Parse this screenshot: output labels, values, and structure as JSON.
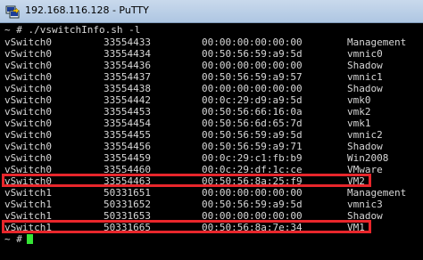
{
  "window": {
    "title": "192.168.116.128 - PuTTY",
    "icon": "putty-icon"
  },
  "terminal": {
    "command_prompt": "~ # ./vswitchInfo.sh -l",
    "rows": [
      [
        "vSwitch0",
        "33554433",
        "00:00:00:00:00:00",
        "Management"
      ],
      [
        "vSwitch0",
        "33554434",
        "00:50:56:59:a9:5d",
        "vmnic0"
      ],
      [
        "vSwitch0",
        "33554436",
        "00:00:00:00:00:00",
        "Shadow"
      ],
      [
        "vSwitch0",
        "33554437",
        "00:50:56:59:a9:57",
        "vmnic1"
      ],
      [
        "vSwitch0",
        "33554438",
        "00:00:00:00:00:00",
        "Shadow"
      ],
      [
        "vSwitch0",
        "33554442",
        "00:0c:29:d9:a9:5d",
        "vmk0"
      ],
      [
        "vSwitch0",
        "33554453",
        "00:50:56:66:16:0a",
        "vmk2"
      ],
      [
        "vSwitch0",
        "33554454",
        "00:50:56:6d:65:7d",
        "vmk1"
      ],
      [
        "vSwitch0",
        "33554455",
        "00:50:56:59:a9:5d",
        "vmnic2"
      ],
      [
        "vSwitch0",
        "33554456",
        "00:50:56:59:a9:71",
        "Shadow"
      ],
      [
        "vSwitch0",
        "33554459",
        "00:0c:29:c1:fb:b9",
        "Win2008"
      ],
      [
        "vSwitch0",
        "33554460",
        "00:0c:29:df:1c:ce",
        "VMware"
      ],
      [
        "vSwitch0",
        "33554463",
        "00:50:56:8a:25:f9",
        "VM2"
      ],
      [
        "vSwitch1",
        "50331651",
        "00:00:00:00:00:00",
        "Management"
      ],
      [
        "vSwitch1",
        "50331652",
        "00:50:56:59:a9:5d",
        "vmnic3"
      ],
      [
        "vSwitch1",
        "50331653",
        "00:00:00:00:00:00",
        "Shadow"
      ],
      [
        "vSwitch1",
        "50331665",
        "00:50:56:8a:7e:34",
        "VM1"
      ]
    ],
    "final_prompt": "~ #",
    "highlighted_rows": [
      12,
      16
    ],
    "colors": {
      "background": "#000000",
      "text": "#d7d7d7",
      "highlight": "#e8262b",
      "cursor": "#36e536"
    }
  }
}
